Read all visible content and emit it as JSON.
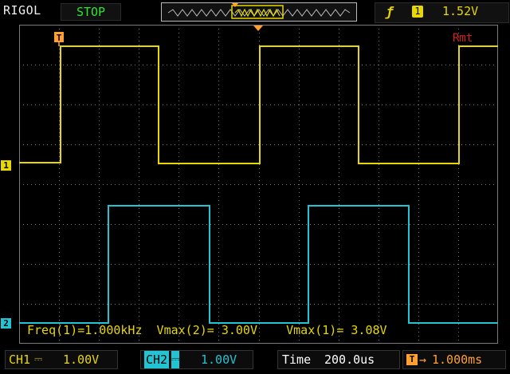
{
  "header": {
    "brand": "RIGOL",
    "run_status": "STOP",
    "trigger_edge_icon": "rising-edge-icon",
    "trigger_source": "1",
    "trigger_level": "1.52V"
  },
  "display": {
    "remote_indicator": "Rmt",
    "trigger_position_marker": "T",
    "ch1_marker": "1",
    "ch2_marker": "2",
    "measurements": "Freq(1)=1.000kHz  Vmax(2)= 3.00V    Vmax(1)= 3.08V"
  },
  "footer": {
    "ch1_label": "CH1",
    "ch1_coupling": "⎓",
    "ch1_scale": "1.00V",
    "ch2_label": "CH2",
    "ch2_coupling": "⎓",
    "ch2_scale": "1.00V",
    "time_label": "Time",
    "time_scale": "200.0us",
    "delay_icon": "trigger-delay-icon",
    "delay_value": "1.000ms"
  },
  "colors": {
    "ch1": "#e8d700",
    "ch2": "#22c4d4",
    "grid": "#7a7a7a",
    "background": "#000000",
    "stop": "#2ee52e",
    "rmt": "#d02020",
    "delay": "#ffa030"
  }
}
